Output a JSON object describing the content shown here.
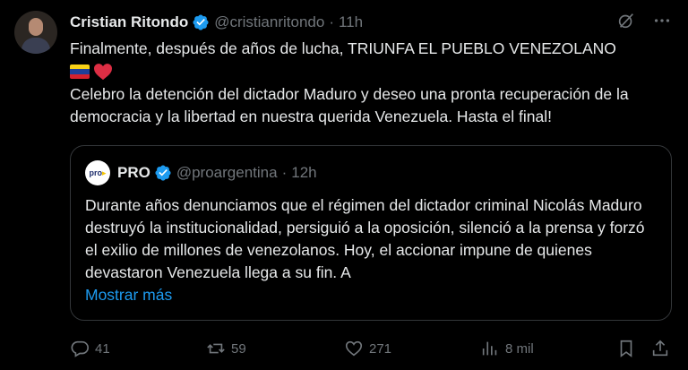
{
  "author": {
    "name": "Cristian Ritondo",
    "handle": "@cristianritondo",
    "separator": "·",
    "time": "11h"
  },
  "tweet": {
    "line1": "Finalmente, después de años de lucha, TRIUNFA EL PUEBLO VENEZOLANO",
    "line2": "Celebro la detención del dictador Maduro y deseo una pronta recuperación de la democracia y la libertad en nuestra querida Venezuela. Hasta el final!"
  },
  "quote": {
    "avatar_text": "pro",
    "name": "PRO",
    "handle": "@proargentina",
    "separator": "·",
    "time": "12h",
    "text": "Durante años denunciamos que el régimen del dictador criminal Nicolás Maduro destruyó la institucionalidad, persiguió a la oposición, silenció a la prensa y forzó el exilio de millones de venezolanos. Hoy, el accionar impune de quienes devastaron Venezuela llega a su fin. A",
    "show_more": "Mostrar más"
  },
  "actions": {
    "replies": "41",
    "reposts": "59",
    "likes": "271",
    "views": "8 mil"
  },
  "icons": [
    "verified-badge-icon",
    "grok-icon",
    "more-icon",
    "venezuela-flag-emoji",
    "red-heart-emoji",
    "reply-icon",
    "repost-icon",
    "like-icon",
    "views-icon",
    "bookmark-icon",
    "share-icon"
  ],
  "colors": {
    "background": "#000000",
    "text": "#e7e9ea",
    "muted": "#71767b",
    "accent": "#1d9bf0",
    "border": "#333639"
  }
}
